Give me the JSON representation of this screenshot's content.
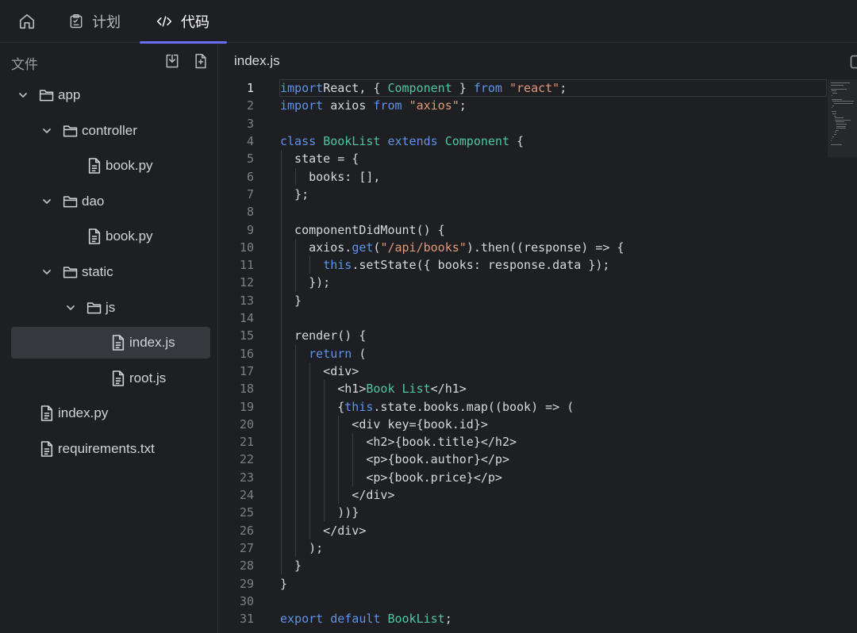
{
  "tabs": {
    "plan_label": "计划",
    "code_label": "代码"
  },
  "sidebar": {
    "title": "文件"
  },
  "tree": [
    {
      "label": "app",
      "type": "folder",
      "depth": 0
    },
    {
      "label": "controller",
      "type": "folder",
      "depth": 1
    },
    {
      "label": "book.py",
      "type": "file",
      "depth": 2
    },
    {
      "label": "dao",
      "type": "folder",
      "depth": 1
    },
    {
      "label": "book.py",
      "type": "file",
      "depth": 2
    },
    {
      "label": "static",
      "type": "folder",
      "depth": 1
    },
    {
      "label": "js",
      "type": "folder",
      "depth": 2
    },
    {
      "label": "index.js",
      "type": "file",
      "depth": 3,
      "selected": true
    },
    {
      "label": "root.js",
      "type": "file",
      "depth": 3
    },
    {
      "label": "index.py",
      "type": "file",
      "depth": 0
    },
    {
      "label": "requirements.txt",
      "type": "file",
      "depth": 0
    }
  ],
  "editor": {
    "filename": "index.js",
    "active_line": 1,
    "lines": [
      {
        "n": "1",
        "t": [
          [
            "kw",
            "import"
          ],
          [
            "",
            "React, { "
          ],
          [
            "ty",
            "Component"
          ],
          [
            "",
            " } "
          ],
          [
            "kw",
            "from"
          ],
          [
            "",
            " "
          ],
          [
            "str",
            "\"react\""
          ],
          [
            "",
            ";"
          ]
        ]
      },
      {
        "n": "2",
        "t": [
          [
            "kw",
            "import"
          ],
          [
            "",
            " axios "
          ],
          [
            "kw",
            "from"
          ],
          [
            "",
            " "
          ],
          [
            "str",
            "\"axios\""
          ],
          [
            "",
            ";"
          ]
        ]
      },
      {
        "n": "3",
        "t": []
      },
      {
        "n": "4",
        "t": [
          [
            "kw",
            "class"
          ],
          [
            "",
            " "
          ],
          [
            "ty",
            "BookList"
          ],
          [
            "",
            " "
          ],
          [
            "kw",
            "extends"
          ],
          [
            "",
            " "
          ],
          [
            "ty",
            "Component"
          ],
          [
            "",
            " {"
          ]
        ]
      },
      {
        "n": "5",
        "t": [
          [
            "",
            "  state = {"
          ]
        ]
      },
      {
        "n": "6",
        "t": [
          [
            "",
            "    books: [],"
          ]
        ]
      },
      {
        "n": "7",
        "t": [
          [
            "",
            "  };"
          ]
        ]
      },
      {
        "n": "8",
        "t": []
      },
      {
        "n": "9",
        "t": [
          [
            "",
            "  componentDidMount() {"
          ]
        ]
      },
      {
        "n": "10",
        "t": [
          [
            "",
            "    axios."
          ],
          [
            "kw",
            "get"
          ],
          [
            "",
            "("
          ],
          [
            "str",
            "\"/api/books\""
          ],
          [
            "",
            ").then((response) => {"
          ]
        ]
      },
      {
        "n": "11",
        "t": [
          [
            "",
            "      "
          ],
          [
            "kw",
            "this"
          ],
          [
            "",
            ".setState({ books: response.data });"
          ]
        ]
      },
      {
        "n": "12",
        "t": [
          [
            "",
            "    });"
          ]
        ]
      },
      {
        "n": "13",
        "t": [
          [
            "",
            "  }"
          ]
        ]
      },
      {
        "n": "14",
        "t": []
      },
      {
        "n": "15",
        "t": [
          [
            "",
            "  render() {"
          ]
        ]
      },
      {
        "n": "16",
        "t": [
          [
            "",
            "    "
          ],
          [
            "kw",
            "return"
          ],
          [
            "",
            " ("
          ]
        ]
      },
      {
        "n": "17",
        "t": [
          [
            "",
            "      <div>"
          ]
        ]
      },
      {
        "n": "18",
        "t": [
          [
            "",
            "        <h1>"
          ],
          [
            "jsx",
            "Book List"
          ],
          [
            "",
            "</h1>"
          ]
        ]
      },
      {
        "n": "19",
        "t": [
          [
            "",
            "        {"
          ],
          [
            "kw",
            "this"
          ],
          [
            "",
            ".state.books.map((book) => ("
          ]
        ]
      },
      {
        "n": "20",
        "t": [
          [
            "",
            "          <div key={book.id}>"
          ]
        ]
      },
      {
        "n": "21",
        "t": [
          [
            "",
            "            <h2>{book.title}</h2>"
          ]
        ]
      },
      {
        "n": "22",
        "t": [
          [
            "",
            "            <p>{book.author}</p>"
          ]
        ]
      },
      {
        "n": "23",
        "t": [
          [
            "",
            "            <p>{book.price}</p>"
          ]
        ]
      },
      {
        "n": "24",
        "t": [
          [
            "",
            "          </div>"
          ]
        ]
      },
      {
        "n": "25",
        "t": [
          [
            "",
            "        ))}"
          ]
        ]
      },
      {
        "n": "26",
        "t": [
          [
            "",
            "      </div>"
          ]
        ]
      },
      {
        "n": "27",
        "t": [
          [
            "",
            "    );"
          ]
        ]
      },
      {
        "n": "28",
        "t": [
          [
            "",
            "  }"
          ]
        ]
      },
      {
        "n": "29",
        "t": [
          [
            "",
            "}"
          ]
        ]
      },
      {
        "n": "30",
        "t": []
      },
      {
        "n": "31",
        "t": [
          [
            "kw",
            "export"
          ],
          [
            "",
            " "
          ],
          [
            "kw",
            "default"
          ],
          [
            "",
            " "
          ],
          [
            "ty",
            "BookList"
          ],
          [
            "",
            ";"
          ]
        ]
      }
    ]
  },
  "colors": {
    "accent": "#6b6ef5",
    "keyword": "#5f93e8",
    "type": "#4fc5a6",
    "string": "#e0997a"
  }
}
